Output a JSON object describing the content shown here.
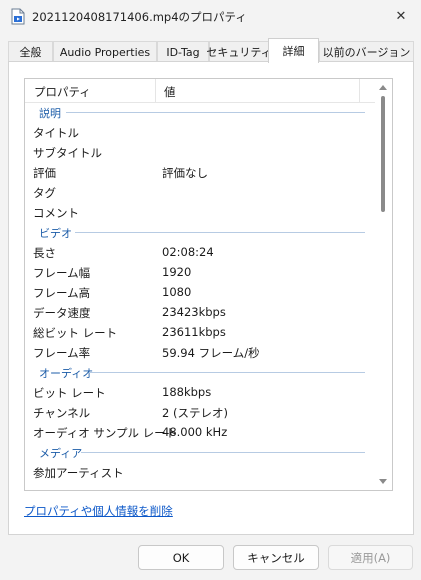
{
  "window": {
    "title": "2021120408171406.mp4のプロパティ",
    "close_glyph": "✕"
  },
  "tabs": [
    {
      "label": "全般",
      "active": false
    },
    {
      "label": "Audio Properties",
      "active": false
    },
    {
      "label": "ID-Tag",
      "active": false
    },
    {
      "label": "セキュリティ",
      "active": false
    },
    {
      "label": "詳細",
      "active": true
    },
    {
      "label": "以前のバージョン",
      "active": false
    }
  ],
  "list": {
    "header": {
      "property": "プロパティ",
      "value": "値"
    },
    "groups": [
      {
        "label": "説明",
        "rows": [
          {
            "key": "タイトル",
            "value": ""
          },
          {
            "key": "サブタイトル",
            "value": ""
          },
          {
            "key": "評価",
            "value": "評価なし"
          },
          {
            "key": "タグ",
            "value": ""
          },
          {
            "key": "コメント",
            "value": ""
          }
        ]
      },
      {
        "label": "ビデオ",
        "rows": [
          {
            "key": "長さ",
            "value": "02:08:24"
          },
          {
            "key": "フレーム幅",
            "value": "1920"
          },
          {
            "key": "フレーム高",
            "value": "1080"
          },
          {
            "key": "データ速度",
            "value": "23423kbps"
          },
          {
            "key": "総ビット レート",
            "value": "23611kbps"
          },
          {
            "key": "フレーム率",
            "value": "59.94 フレーム/秒"
          }
        ]
      },
      {
        "label": "オーディオ",
        "rows": [
          {
            "key": "ビット レート",
            "value": "188kbps"
          },
          {
            "key": "チャンネル",
            "value": "2 (ステレオ)"
          },
          {
            "key": "オーディオ サンプル レート",
            "value": "48.000 kHz"
          }
        ]
      },
      {
        "label": "メディア",
        "rows": [
          {
            "key": "参加アーティスト",
            "value": ""
          }
        ]
      }
    ]
  },
  "remove_link": "プロパティや個人情報を削除",
  "buttons": {
    "ok": "OK",
    "cancel": "キャンセル",
    "apply": "適用(A)"
  },
  "colors": {
    "group_label": "#1c5ca8",
    "link": "#0b57c8",
    "accent": "#0067c0"
  }
}
